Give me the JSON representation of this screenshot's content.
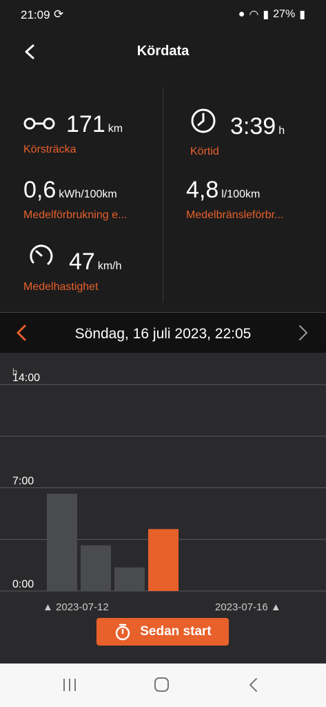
{
  "status": {
    "time": "21:09",
    "battery": "27%"
  },
  "app": {
    "title": "Kördata"
  },
  "stats": {
    "distance": {
      "value": "171",
      "unit": "km",
      "label": "Körsträcka"
    },
    "time": {
      "value": "3:39",
      "unit": "h",
      "label": "Körtid"
    },
    "consumption_kwh": {
      "value": "0,6",
      "unit": "kWh/100km",
      "label": "Medelförbrukning e..."
    },
    "consumption_fuel": {
      "value": "4,8",
      "unit": "l/100km",
      "label": "Medelbränsleförbr..."
    },
    "speed": {
      "value": "47",
      "unit": "km/h",
      "label": "Medelhastighet"
    }
  },
  "datebar": {
    "date": "Söndag, 16 juli 2023, 22:05"
  },
  "chart_data": {
    "type": "bar",
    "ylabel": "h",
    "yticks": [
      "14:00",
      "7:00",
      "0:00"
    ],
    "ylim": [
      0,
      14
    ],
    "categories": [
      "2023-07-12",
      "",
      "",
      "2023-07-16"
    ],
    "x_labels": [
      "2023-07-12",
      "2023-07-16"
    ],
    "values": [
      6.6,
      3.1,
      1.6,
      4.2
    ],
    "colors": [
      "#4a4b4e",
      "#4a4b4e",
      "#4a4b4e",
      "#e8602a"
    ],
    "grid": true
  },
  "button": {
    "label": "Sedan start"
  }
}
